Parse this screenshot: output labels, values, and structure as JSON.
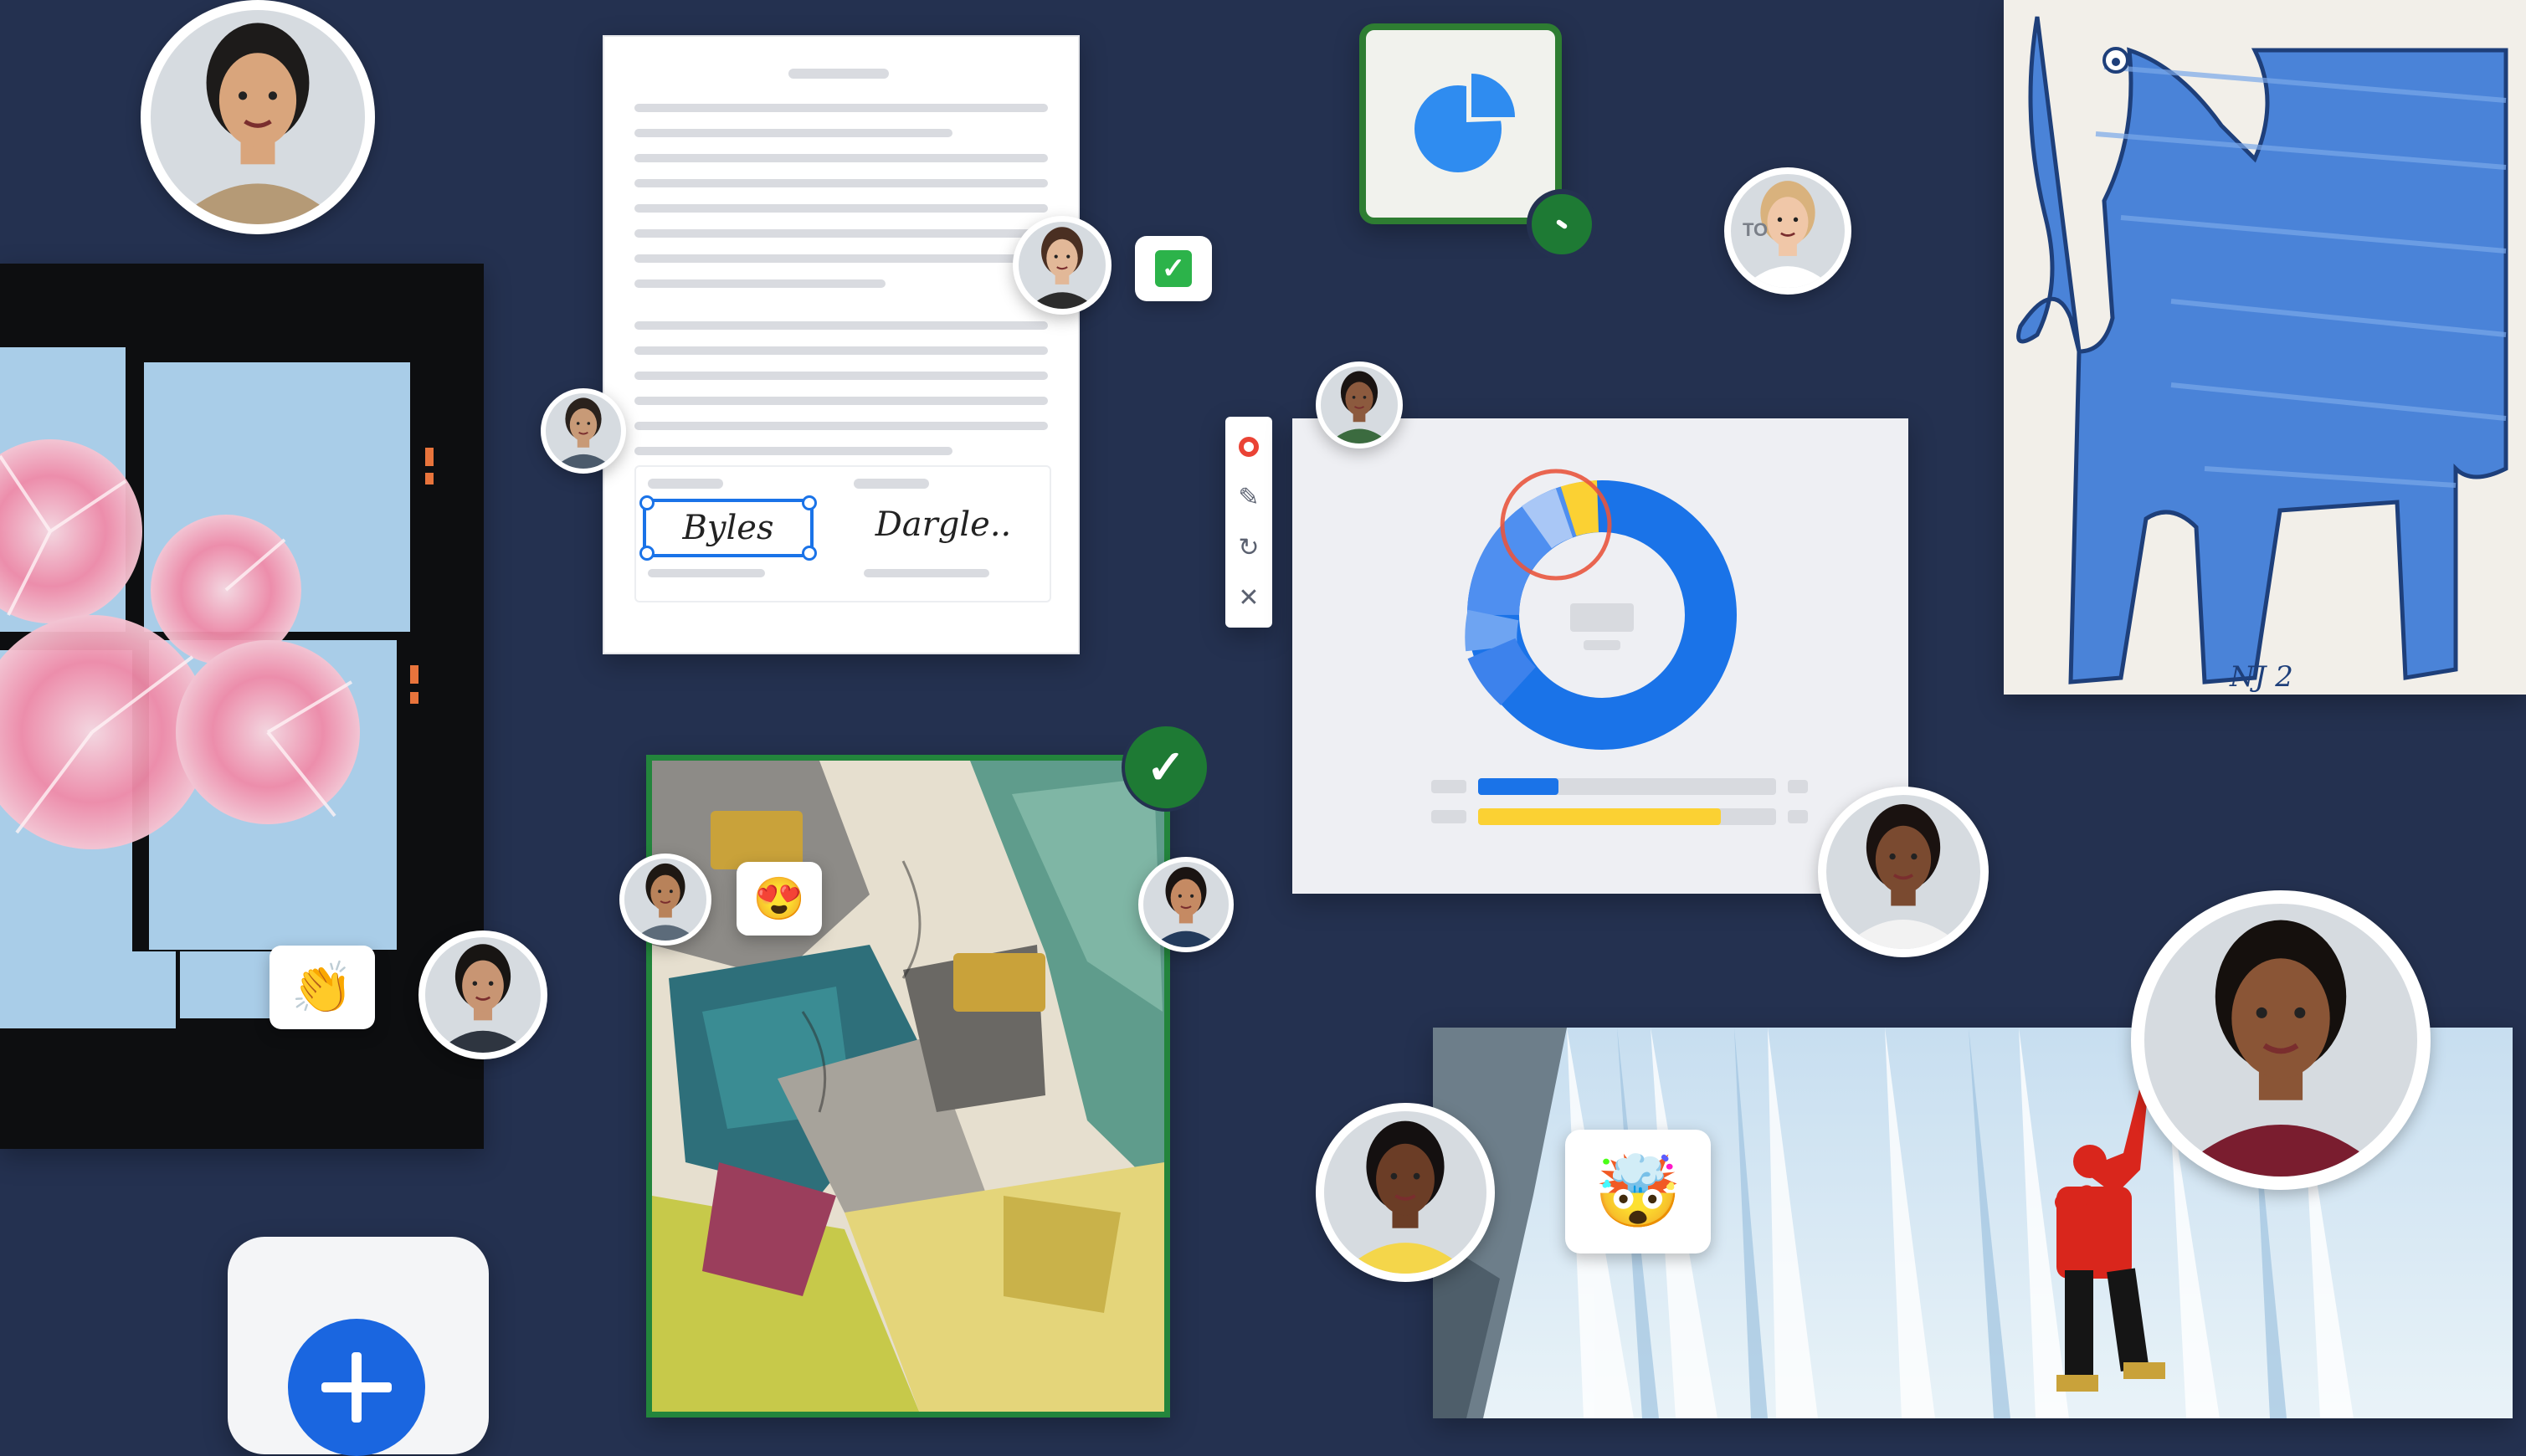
{
  "colors": {
    "background": "#243150",
    "accent_blue": "#1a73e8",
    "accent_green": "#188038",
    "accent_yellow": "#fbd133",
    "record_red": "#ea4335"
  },
  "document": {
    "signature_1": "Byles",
    "signature_2": "Dargle.."
  },
  "avatars": [
    {
      "name": "avatar-top-left",
      "skin": "#d9a57c",
      "hair": "#1d1b1a",
      "shirt": "#b59a76"
    },
    {
      "name": "avatar-doc-left",
      "skin": "#c89a77",
      "hair": "#2a221d",
      "shirt": "#4b5a6b"
    },
    {
      "name": "avatar-doc-right",
      "skin": "#e2b898",
      "hair": "#4a2f22",
      "shirt": "#2c2c2c"
    },
    {
      "name": "avatar-to",
      "skin": "#f0c7a8",
      "hair": "#d9b27d",
      "shirt": "#ffffff"
    },
    {
      "name": "avatar-chart-top",
      "skin": "#8c5a3e",
      "hair": "#1a1412",
      "shirt": "#3b6b3f"
    },
    {
      "name": "avatar-chart-bottom",
      "skin": "#7a4a30",
      "hair": "#1a1210",
      "shirt": "#f2f2f2"
    },
    {
      "name": "avatar-collage-left",
      "skin": "#b8825a",
      "hair": "#1e1813",
      "shirt": "#5c6b7a"
    },
    {
      "name": "avatar-collage-right",
      "skin": "#c58a63",
      "hair": "#1a1412",
      "shirt": "#233b5c"
    },
    {
      "name": "avatar-photo-left",
      "skin": "#c89573",
      "hair": "#181513",
      "shirt": "#2e3540"
    },
    {
      "name": "avatar-glasses",
      "skin": "#6b3d26",
      "hair": "#141010",
      "shirt": "#f4d64a"
    },
    {
      "name": "avatar-large-right",
      "skin": "#8a5536",
      "hair": "#15100d",
      "shirt": "#7a1d2f"
    }
  ],
  "toolbar": {
    "record_icon": "record-icon",
    "pen_icon": "pen-icon",
    "redo_icon": "redo-icon",
    "close_icon": "close-icon"
  },
  "avatar_to_initials": "TO",
  "emojis": {
    "heart_eyes": "😍",
    "clapping": "👏",
    "mind_blown": "🤯",
    "checkbox": "✓"
  },
  "fab": {
    "icon": "plus-icon"
  }
}
